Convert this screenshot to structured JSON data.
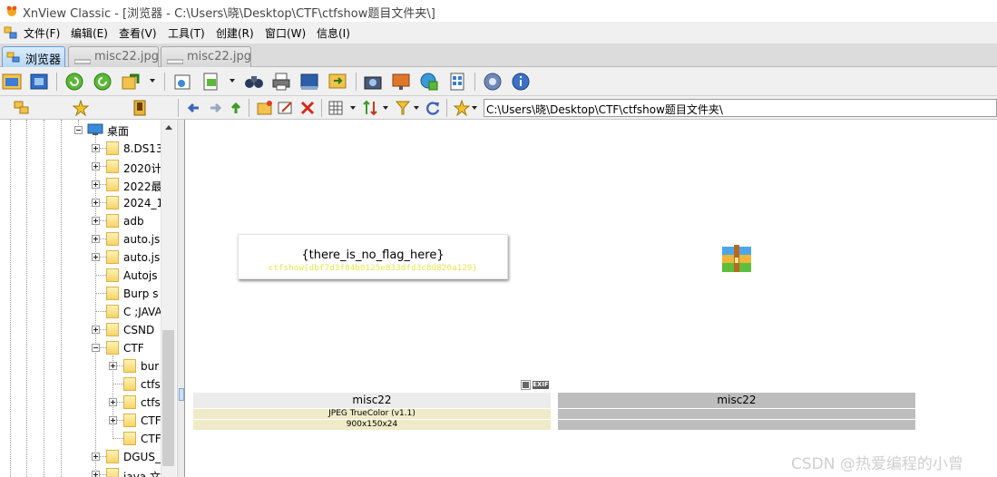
{
  "window": {
    "title": "XnView Classic - [浏览器 - C:\\Users\\晓\\Desktop\\CTF\\ctfshow题目文件夹\\]"
  },
  "menu": [
    "文件(F)",
    "编辑(E)",
    "查看(V)",
    "工具(T)",
    "创建(R)",
    "窗口(W)",
    "信息(I)"
  ],
  "tabs": [
    {
      "label": "浏览器",
      "active": true
    },
    {
      "label": "misc22.jpg",
      "active": false
    },
    {
      "label": "misc22.jpg",
      "active": false
    }
  ],
  "address": {
    "path": "C:\\Users\\晓\\Desktop\\CTF\\ctfshow题目文件夹\\"
  },
  "tree": {
    "root": "桌面",
    "items": [
      "8.DS13",
      "2020计",
      "2022最",
      "2024_1",
      "adb",
      "auto.js",
      "auto.js",
      "Autojs",
      "Burp s",
      "C ;JAVA",
      "CSND",
      "CTF"
    ],
    "ctf_children": [
      "bur",
      "ctfs",
      "ctfs",
      "CTF",
      "CTF"
    ],
    "after": [
      "DGUS_",
      "java 文"
    ]
  },
  "preview": {
    "line1": "{there_is_no_flag_here}",
    "line2": "ctfshow{dbf7d3f84b0125e833dfd3c80820a129}"
  },
  "files": [
    {
      "name": "misc22",
      "format": "JPEG TrueColor (v1.1)",
      "dims": "900x150x24",
      "badge": "EXIF"
    },
    {
      "name": "misc22",
      "format": "",
      "dims": ""
    }
  ],
  "watermark": "CSDN @热爱编程的小曾",
  "colors": {
    "accent": "#6b9dd1",
    "card_info": "#efebc8",
    "card_name": "#ececec",
    "selected_card": "#bdbdbd"
  }
}
